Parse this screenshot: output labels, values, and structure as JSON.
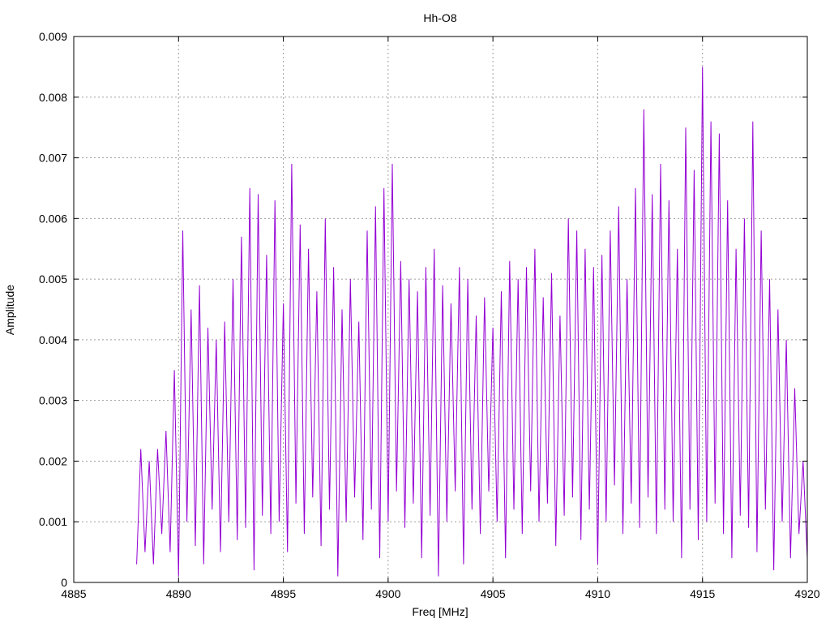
{
  "chart_data": {
    "type": "line",
    "title": "Hh-O8",
    "xlabel": "Freq [MHz]",
    "ylabel": "Amplitude",
    "xlim": [
      4885,
      4920
    ],
    "ylim": [
      0,
      0.009
    ],
    "grid": true,
    "x_ticks": [
      "4885",
      "4890",
      "4895",
      "4900",
      "4905",
      "4910",
      "4915",
      "4920"
    ],
    "y_ticks": [
      "0",
      "0.001",
      "0.002",
      "0.003",
      "0.004",
      "0.005",
      "0.006",
      "0.007",
      "0.008",
      "0.009"
    ],
    "series": [
      {
        "color": "#9400d3",
        "x": [
          4888.0,
          4888.2,
          4888.4,
          4888.6,
          4888.8,
          4889.0,
          4889.2,
          4889.4,
          4889.6,
          4889.8,
          4890.0,
          4890.2,
          4890.4,
          4890.6,
          4890.8,
          4891.0,
          4891.2,
          4891.4,
          4891.6,
          4891.8,
          4892.0,
          4892.2,
          4892.4,
          4892.6,
          4892.8,
          4893.0,
          4893.2,
          4893.4,
          4893.6,
          4893.8,
          4894.0,
          4894.2,
          4894.4,
          4894.6,
          4894.8,
          4895.0,
          4895.2,
          4895.4,
          4895.6,
          4895.8,
          4896.0,
          4896.2,
          4896.4,
          4896.6,
          4896.8,
          4897.0,
          4897.2,
          4897.4,
          4897.6,
          4897.8,
          4898.0,
          4898.2,
          4898.4,
          4898.6,
          4898.8,
          4899.0,
          4899.2,
          4899.4,
          4899.6,
          4899.8,
          4900.0,
          4900.2,
          4900.4,
          4900.6,
          4900.8,
          4901.0,
          4901.2,
          4901.4,
          4901.6,
          4901.8,
          4902.0,
          4902.2,
          4902.4,
          4902.6,
          4902.8,
          4903.0,
          4903.2,
          4903.4,
          4903.6,
          4903.8,
          4904.0,
          4904.2,
          4904.4,
          4904.6,
          4904.8,
          4905.0,
          4905.2,
          4905.4,
          4905.6,
          4905.8,
          4906.0,
          4906.2,
          4906.4,
          4906.6,
          4906.8,
          4907.0,
          4907.2,
          4907.4,
          4907.6,
          4907.8,
          4908.0,
          4908.2,
          4908.4,
          4908.6,
          4908.8,
          4909.0,
          4909.2,
          4909.4,
          4909.6,
          4909.8,
          4910.0,
          4910.2,
          4910.4,
          4910.6,
          4910.8,
          4911.0,
          4911.2,
          4911.4,
          4911.6,
          4911.8,
          4912.0,
          4912.2,
          4912.4,
          4912.6,
          4912.8,
          4913.0,
          4913.2,
          4913.4,
          4913.6,
          4913.8,
          4914.0,
          4914.2,
          4914.4,
          4914.6,
          4914.8,
          4915.0,
          4915.2,
          4915.4,
          4915.6,
          4915.8,
          4916.0,
          4916.2,
          4916.4,
          4916.6,
          4916.8,
          4917.0,
          4917.2,
          4917.4,
          4917.6,
          4917.8,
          4918.0,
          4918.2,
          4918.4,
          4918.6,
          4918.8,
          4919.0,
          4919.2,
          4919.4,
          4919.6,
          4919.8,
          4920.0
        ],
        "y": [
          0.0003,
          0.0022,
          0.0005,
          0.002,
          0.0003,
          0.0022,
          0.0008,
          0.0025,
          0.0005,
          0.0035,
          0.0001,
          0.0058,
          0.001,
          0.0045,
          0.0006,
          0.0049,
          0.0003,
          0.0042,
          0.0012,
          0.004,
          0.0005,
          0.0043,
          0.001,
          0.005,
          0.0007,
          0.0057,
          0.0009,
          0.0065,
          0.0002,
          0.0064,
          0.0011,
          0.0054,
          0.0008,
          0.0063,
          0.001,
          0.0046,
          0.0005,
          0.0069,
          0.0013,
          0.0059,
          0.0008,
          0.0055,
          0.0014,
          0.0048,
          0.0006,
          0.006,
          0.0012,
          0.0052,
          0.0001,
          0.0045,
          0.001,
          0.005,
          0.0014,
          0.0043,
          0.0007,
          0.0058,
          0.0012,
          0.0062,
          0.0004,
          0.0065,
          0.001,
          0.0069,
          0.0015,
          0.0053,
          0.0009,
          0.005,
          0.0013,
          0.0048,
          0.0004,
          0.0052,
          0.0011,
          0.0055,
          0.0001,
          0.0049,
          0.001,
          0.0046,
          0.0015,
          0.0052,
          0.0003,
          0.005,
          0.0012,
          0.0044,
          0.0008,
          0.0047,
          0.0015,
          0.0042,
          0.001,
          0.0048,
          0.0004,
          0.0053,
          0.0012,
          0.005,
          0.0008,
          0.0052,
          0.0015,
          0.0055,
          0.001,
          0.0047,
          0.0013,
          0.0051,
          0.0006,
          0.0044,
          0.0011,
          0.006,
          0.0014,
          0.0058,
          0.0007,
          0.0055,
          0.0012,
          0.0052,
          0.0003,
          0.0054,
          0.001,
          0.0058,
          0.0016,
          0.0062,
          0.0008,
          0.005,
          0.0013,
          0.0065,
          0.0009,
          0.0078,
          0.0014,
          0.0064,
          0.0008,
          0.0069,
          0.0012,
          0.0063,
          0.001,
          0.0055,
          0.0004,
          0.0075,
          0.0012,
          0.0068,
          0.0007,
          0.0085,
          0.001,
          0.0076,
          0.0013,
          0.0074,
          0.0008,
          0.0063,
          0.0004,
          0.0055,
          0.0011,
          0.006,
          0.0009,
          0.0076,
          0.0005,
          0.0058,
          0.0012,
          0.005,
          0.0002,
          0.0045,
          0.001,
          0.004,
          0.0004,
          0.0032,
          0.0008,
          0.002,
          0.0004
        ]
      }
    ]
  }
}
